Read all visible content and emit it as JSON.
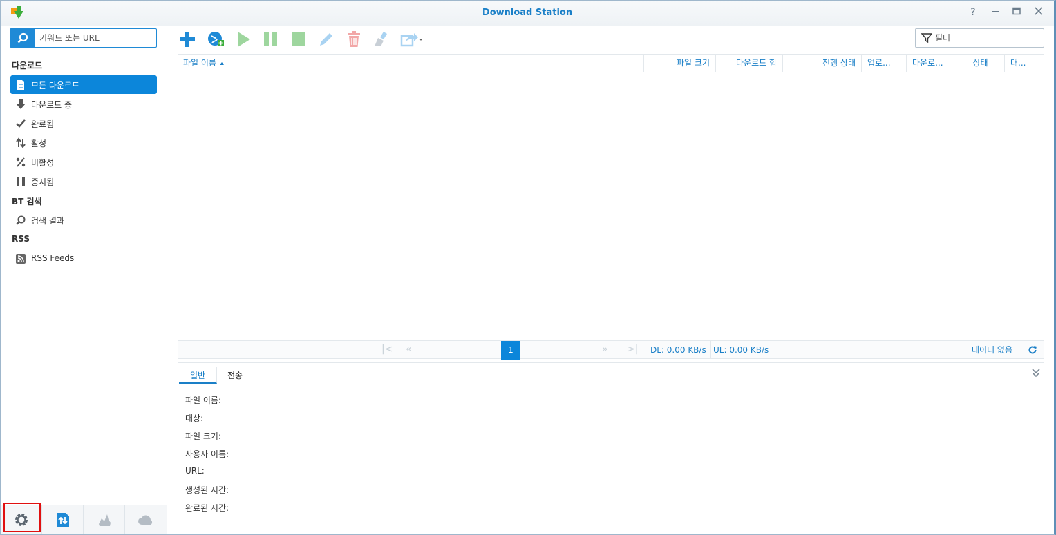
{
  "window": {
    "title": "Download Station"
  },
  "search": {
    "placeholder": "키워드 또는 URL"
  },
  "filter": {
    "placeholder": "필터"
  },
  "sidebar": {
    "sections": [
      {
        "title": "다운로드"
      },
      {
        "title": "BT 검색"
      },
      {
        "title": "RSS"
      }
    ],
    "items": [
      {
        "label": "모든 다운로드",
        "icon": "file-icon",
        "active": true
      },
      {
        "label": "다운로드 중",
        "icon": "download-arrow-icon"
      },
      {
        "label": "완료됨",
        "icon": "check-icon"
      },
      {
        "label": "활성",
        "icon": "up-down-arrows-icon"
      },
      {
        "label": "비활성",
        "icon": "percent-icon"
      },
      {
        "label": "중지됨",
        "icon": "pause-icon"
      },
      {
        "label": "검색 결과",
        "icon": "magnifier-icon"
      },
      {
        "label": "RSS Feeds",
        "icon": "rss-icon"
      }
    ],
    "bottom_buttons": [
      "settings-icon",
      "transfer-icon",
      "emule-icon",
      "cloud-icon"
    ]
  },
  "toolbar": {
    "buttons": [
      "add-icon",
      "add-url-icon",
      "resume-icon",
      "pause-icon",
      "stop-icon",
      "edit-icon",
      "delete-icon",
      "clean-up-icon",
      "share-icon"
    ]
  },
  "grid": {
    "columns": [
      "파일 이름",
      "파일 크기",
      "다운로드 함",
      "진행 상태",
      "업로...",
      "다운로...",
      "상태",
      "대..."
    ]
  },
  "pager": {
    "page": "1",
    "dl_rate": "DL: 0.00 KB/s",
    "ul_rate": "UL: 0.00 KB/s",
    "status": "데이터 없음"
  },
  "details": {
    "tabs": [
      "일반",
      "전송"
    ],
    "fields": [
      "파일 이름:",
      "대상:",
      "파일 크기:",
      "사용자 이름:",
      "URL:",
      "생성된 시간:",
      "완료된 시간:"
    ]
  },
  "colors": {
    "accent": "#0c86da",
    "highlight": "#e01010"
  }
}
